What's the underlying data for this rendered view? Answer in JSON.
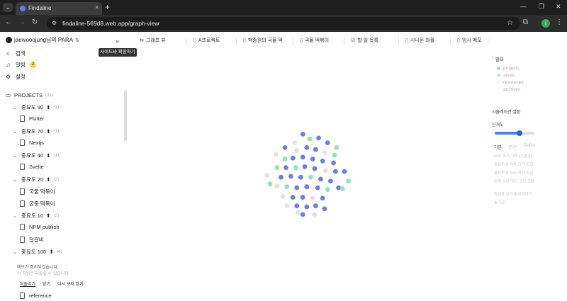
{
  "browser": {
    "tab_title": "Findaline",
    "tab_close": "×",
    "new_tab": "+",
    "url": "findaline-569d8.web.app/graph-view",
    "profile_initial": "j"
  },
  "sidebar": {
    "workspace": "jaewooojung님의 PARA",
    "tooltip": "사이드바 확장하기",
    "menu": [
      {
        "label": "검색",
        "icon": "search-icon"
      },
      {
        "label": "알림",
        "icon": "bell-icon",
        "badge": "2"
      },
      {
        "label": "설정",
        "icon": "gear-icon"
      }
    ],
    "projects_label": "PROJECTS",
    "projects_count": "(31)",
    "groups": [
      {
        "label": "중요도 90",
        "count": "(1)",
        "items": [
          "Flutter"
        ]
      },
      {
        "label": "중요도 70",
        "count": "(1)",
        "items": [
          "Nextjs"
        ]
      },
      {
        "label": "중요도 40",
        "count": "(1)",
        "items": [
          "Svelte"
        ]
      },
      {
        "label": "중요도 20",
        "count": "(2)",
        "items": [
          "국물 떡볶이",
          "궁중 떡볶이"
        ]
      },
      {
        "label": "중요도 10",
        "count": "(2)",
        "items": [
          "NPM publish",
          "달걀비"
        ]
      },
      {
        "label": "중요도 100",
        "count": "(4)",
        "items": []
      }
    ],
    "notice_line1": "메모가 정리되었습니다.",
    "notice_line2": "이 작업은 되돌릴 수 있습니다.",
    "notice_actions": [
      "되돌리기",
      "닫기",
      "다시 보지 않기"
    ],
    "reference_label": "reference"
  },
  "top_tabs": [
    {
      "label": "그래프 뷰",
      "icon": "graph-icon"
    },
    {
      "label": "A프로젝트",
      "icon": "file-icon"
    },
    {
      "label": "백종원의 국물 떡",
      "icon": "file-icon"
    },
    {
      "label": "국물 떡볶이",
      "icon": "file-icon"
    },
    {
      "label": "할 일 목록",
      "icon": "checkbox-icon"
    },
    {
      "label": "시나몬 와플",
      "icon": "file-icon"
    },
    {
      "label": "임시 메모",
      "icon": "file-icon"
    }
  ],
  "right_panel": {
    "filter_title": "필터",
    "filters": [
      {
        "label": "projects",
        "color": "#c8c8e8"
      },
      {
        "label": "areas",
        "color": "#b9ecd2"
      },
      {
        "label": "resources",
        "color": "#f3f3f3"
      },
      {
        "label": "archives",
        "color": "#ffffff"
      }
    ],
    "sim_title": "시뮬레이션 설정",
    "slider_label": "산개도",
    "slider_value": 0.62,
    "modes": [
      "기본",
      "분산",
      "PARA"
    ],
    "options": [
      "노드 크기 고정 (기본값)",
      "중요도에 따라 크기 조절",
      "중요도에 따라 색상 조절",
      "관계 수에 따라 크기 조절"
    ],
    "settings_links": [
      "화살표 보기 활성화하기",
      "초기화"
    ]
  },
  "graph": {
    "colors": {
      "project": "#6b7ee8",
      "area": "#8ee6b2",
      "resource": "#e3e3e3",
      "archive": "#fae6b4"
    },
    "nodes": [
      [
        "p",
        0.48,
        0.07
      ],
      [
        "r",
        0.4,
        0.16
      ],
      [
        "a",
        0.55,
        0.12
      ],
      [
        "p",
        0.64,
        0.11
      ],
      [
        "p",
        0.73,
        0.16
      ],
      [
        "a",
        0.82,
        0.21
      ],
      [
        "p",
        0.3,
        0.21
      ],
      [
        "r",
        0.42,
        0.24
      ],
      [
        "p",
        0.52,
        0.21
      ],
      [
        "p",
        0.61,
        0.23
      ],
      [
        "r",
        0.7,
        0.26
      ],
      [
        "a",
        0.8,
        0.29
      ],
      [
        "r",
        0.21,
        0.28
      ],
      [
        "a",
        0.3,
        0.33
      ],
      [
        "p",
        0.38,
        0.32
      ],
      [
        "p",
        0.48,
        0.31
      ],
      [
        "p",
        0.58,
        0.33
      ],
      [
        "p",
        0.68,
        0.35
      ],
      [
        "p",
        0.79,
        0.37
      ],
      [
        "a",
        0.22,
        0.42
      ],
      [
        "p",
        0.31,
        0.42
      ],
      [
        "a",
        0.41,
        0.42
      ],
      [
        "p",
        0.5,
        0.41
      ],
      [
        "p",
        0.6,
        0.43
      ],
      [
        "r",
        0.71,
        0.45
      ],
      [
        "p",
        0.81,
        0.46
      ],
      [
        "r",
        0.12,
        0.5
      ],
      [
        "p",
        0.26,
        0.52
      ],
      [
        "p",
        0.36,
        0.51
      ],
      [
        "p",
        0.46,
        0.52
      ],
      [
        "a",
        0.56,
        0.52
      ],
      [
        "p",
        0.66,
        0.54
      ],
      [
        "p",
        0.76,
        0.56
      ],
      [
        "p",
        0.9,
        0.46
      ],
      [
        "r",
        0.22,
        0.61
      ],
      [
        "a",
        0.32,
        0.62
      ],
      [
        "p",
        0.42,
        0.63
      ],
      [
        "p",
        0.52,
        0.62
      ],
      [
        "p",
        0.63,
        0.63
      ],
      [
        "a",
        0.73,
        0.65
      ],
      [
        "p",
        0.84,
        0.63
      ],
      [
        "r",
        0.28,
        0.72
      ],
      [
        "p",
        0.38,
        0.73
      ],
      [
        "p",
        0.48,
        0.73
      ],
      [
        "r",
        0.58,
        0.74
      ],
      [
        "p",
        0.68,
        0.74
      ],
      [
        "a",
        0.88,
        0.64
      ],
      [
        "r",
        0.32,
        0.82
      ],
      [
        "p",
        0.42,
        0.82
      ],
      [
        "p",
        0.52,
        0.83
      ],
      [
        "p",
        0.61,
        0.82
      ],
      [
        "p",
        0.7,
        0.85
      ],
      [
        "p",
        0.48,
        0.91
      ],
      [
        "r",
        0.6,
        0.91
      ],
      [
        "a",
        0.15,
        0.59
      ],
      [
        "r",
        0.43,
        0.89
      ],
      [
        "a",
        0.94,
        0.56
      ]
    ]
  }
}
